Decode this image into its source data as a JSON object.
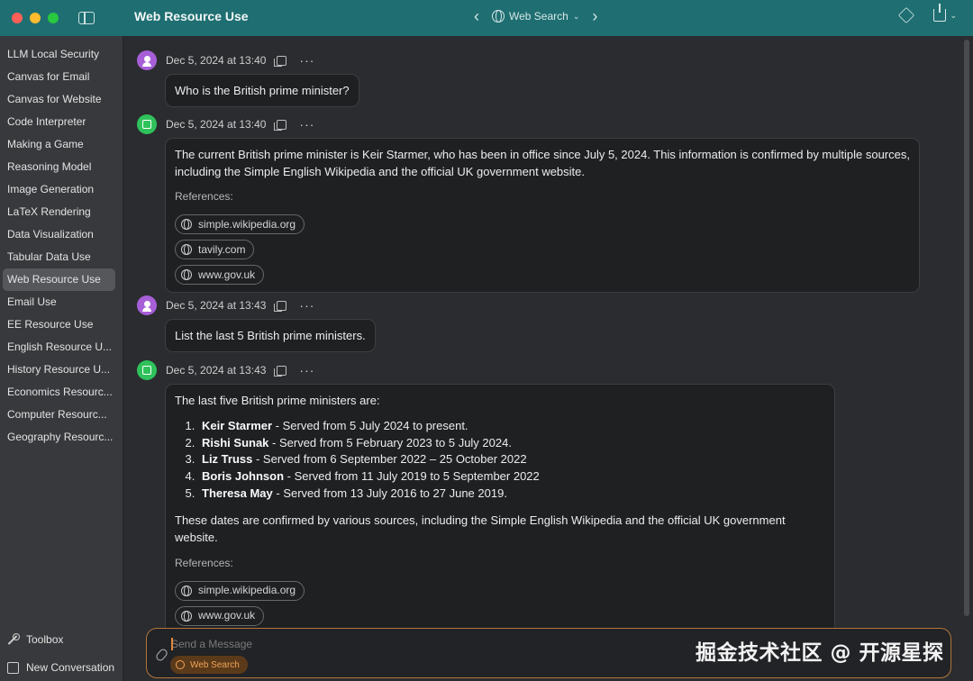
{
  "window": {
    "title": "Web Resource Use"
  },
  "toolbar": {
    "mode_label": "Web Search"
  },
  "sidebar": {
    "items": [
      {
        "label": "LLM Local Security"
      },
      {
        "label": "Canvas for Email"
      },
      {
        "label": "Canvas for Website"
      },
      {
        "label": "Code Interpreter"
      },
      {
        "label": "Making a Game"
      },
      {
        "label": "Reasoning Model"
      },
      {
        "label": "Image Generation"
      },
      {
        "label": "LaTeX Rendering"
      },
      {
        "label": "Data Visualization"
      },
      {
        "label": "Tabular Data Use"
      },
      {
        "label": "Web Resource Use",
        "active": true
      },
      {
        "label": "Email Use"
      },
      {
        "label": "EE Resource Use"
      },
      {
        "label": "English Resource U..."
      },
      {
        "label": "History Resource U..."
      },
      {
        "label": "Economics Resourc..."
      },
      {
        "label": "Computer Resourc..."
      },
      {
        "label": "Geography Resourc..."
      }
    ],
    "toolbox_label": "Toolbox",
    "new_conversation_label": "New Conversation"
  },
  "messages": [
    {
      "role": "user",
      "timestamp": "Dec 5, 2024 at 13:40",
      "text": "Who is the British prime minister?"
    },
    {
      "role": "assistant",
      "timestamp": "Dec 5, 2024 at 13:40",
      "text": "The current British prime minister is Keir Starmer, who has been in office since July 5, 2024. This information is confirmed by multiple sources, including the Simple English Wikipedia and the official UK government website.",
      "references_label": "References:",
      "references": [
        "simple.wikipedia.org",
        "tavily.com",
        "www.gov.uk"
      ]
    },
    {
      "role": "user",
      "timestamp": "Dec 5, 2024 at 13:43",
      "text": "List the last 5 British prime ministers."
    },
    {
      "role": "assistant",
      "timestamp": "Dec 5, 2024 at 13:43",
      "intro": "The last five British prime ministers are:",
      "list": [
        {
          "name": "Keir Starmer",
          "detail": " - Served from 5 July 2024 to present."
        },
        {
          "name": "Rishi Sunak",
          "detail": " - Served from 5 February 2023 to 5 July 2024."
        },
        {
          "name": "Liz Truss",
          "detail": " - Served from 6 September 2022 – 25 October 2022"
        },
        {
          "name": "Boris Johnson",
          "detail": " - Served from 11 July 2019 to 5 September 2022"
        },
        {
          "name": "Theresa May",
          "detail": " - Served from 13 July 2016 to 27 June 2019."
        }
      ],
      "outro": "These dates are confirmed by various sources, including the Simple English Wikipedia and the official UK government website.",
      "references_label": "References:",
      "references": [
        "simple.wikipedia.org",
        "www.gov.uk"
      ]
    }
  ],
  "composer": {
    "placeholder": "Send a Message",
    "chip_label": "Web Search"
  },
  "watermark": {
    "text": "掘金技术社区 @ 开源星探"
  },
  "colors": {
    "titlebar": "#1f6f72",
    "accent_orange": "#b1773b",
    "user_avatar": "#a75fd8",
    "bot_avatar": "#2fc25b"
  }
}
